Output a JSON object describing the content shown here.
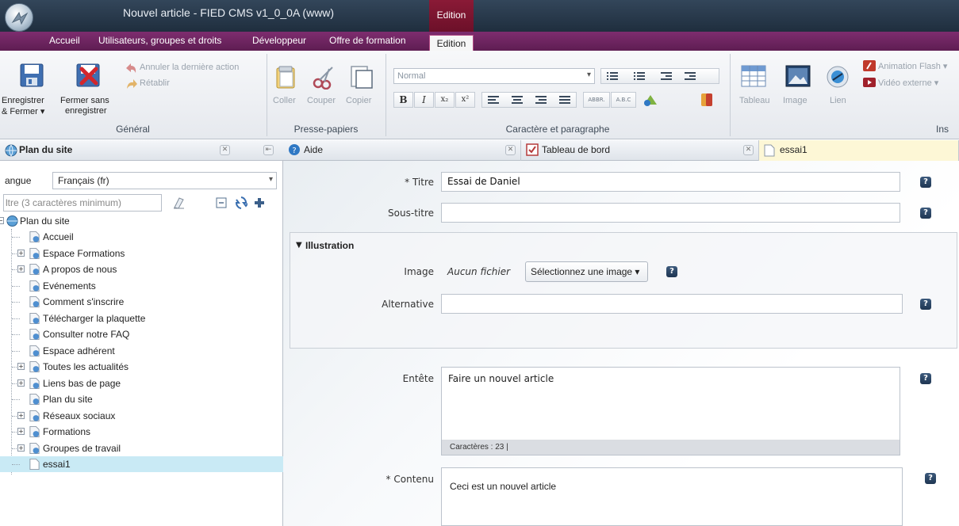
{
  "window": {
    "title": "Nouvel article - FIED CMS v1_0_0A (www)",
    "context_tab": "Edition"
  },
  "ribbon_tabs": [
    {
      "label": "Accueil"
    },
    {
      "label": "Utilisateurs, groupes et droits"
    },
    {
      "label": "Développeur"
    },
    {
      "label": "Offre de formation"
    },
    {
      "label": "Edition",
      "active": true
    }
  ],
  "ribbon": {
    "general": {
      "label": "Général",
      "save_label_1": "Enregistrer",
      "save_label_2": "& Fermer ▾",
      "close_label_1": "Fermer sans",
      "close_label_2": "enregistrer",
      "undo_label": "Annuler la dernière action",
      "redo_label": "Rétablir"
    },
    "clipboard": {
      "label": "Presse-papiers",
      "paste": "Coller",
      "cut": "Couper",
      "copy": "Copier"
    },
    "format": {
      "label": "Caractère et paragraphe",
      "style_value": "Normal",
      "bold": "B",
      "italic": "I",
      "subscript": "x₂",
      "superscript": "x²",
      "abbr": "ABBR.",
      "acronym": "A.B.C"
    },
    "insert": {
      "label": "Ins",
      "table": "Tableau",
      "image": "Image",
      "link": "Lien",
      "flash": "Animation Flash ▾",
      "video": "Vidéo externe ▾"
    }
  },
  "sidebar": {
    "title": "Plan du site",
    "lang_label": "angue",
    "lang_value": "Français (fr)",
    "filter_placeholder": "ltre (3 caractères minimum)",
    "root": "Plan du site",
    "items": [
      {
        "label": "Accueil",
        "expandable": false
      },
      {
        "label": "Espace Formations",
        "expandable": true
      },
      {
        "label": "A propos de nous",
        "expandable": true
      },
      {
        "label": "Evénements",
        "expandable": false
      },
      {
        "label": "Comment s'inscrire",
        "expandable": false
      },
      {
        "label": "Télécharger la plaquette",
        "expandable": false
      },
      {
        "label": "Consulter notre FAQ",
        "expandable": false
      },
      {
        "label": "Espace adhérent",
        "expandable": false
      },
      {
        "label": "Toutes les actualités",
        "expandable": true
      },
      {
        "label": "Liens bas de page",
        "expandable": true
      },
      {
        "label": "Plan du site",
        "expandable": false
      },
      {
        "label": "Réseaux sociaux",
        "expandable": true
      },
      {
        "label": "Formations",
        "expandable": true
      },
      {
        "label": "Groupes de travail",
        "expandable": true
      },
      {
        "label": "essai1",
        "expandable": false,
        "selected": true
      }
    ]
  },
  "doc_tabs": [
    {
      "label": "Aide"
    },
    {
      "label": "Tableau de bord"
    },
    {
      "label": "essai1"
    }
  ],
  "form": {
    "titre_label": "* Titre",
    "titre_value": "Essai de Daniel",
    "sous_titre_label": "Sous-titre",
    "sous_titre_value": "",
    "illustration_label": "Illustration",
    "image_label": "Image",
    "image_value": "Aucun fichier",
    "select_image_label": "Sélectionnez une image ▾",
    "alternative_label": "Alternative",
    "alternative_value": "",
    "entete_label": "Entête",
    "entete_value": "Faire un nouvel article",
    "entete_count": "Caractères : 23 |",
    "contenu_label": "* Contenu",
    "contenu_value": "Ceci est un nouvel article",
    "help_glyph": "?"
  },
  "colors": {
    "titlebar": "#1f2e3e",
    "tabrow": "#7e2d6f",
    "context": "#8a1a36",
    "selection": "#c9eaf5",
    "help": "#1f3652"
  }
}
